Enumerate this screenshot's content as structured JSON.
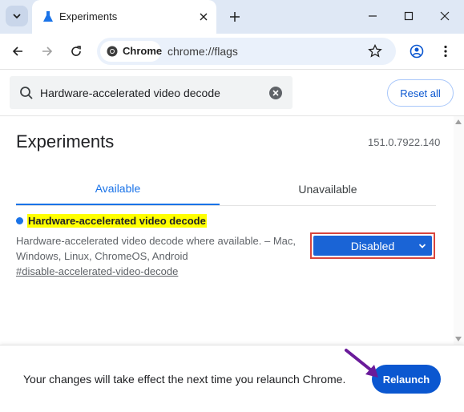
{
  "browser": {
    "tab": {
      "title": "Experiments"
    },
    "omnibox": {
      "chip_label": "Chrome",
      "url": "chrome://flags"
    }
  },
  "search": {
    "value": "Hardware-accelerated video decode",
    "reset_label": "Reset all"
  },
  "page": {
    "title": "Experiments",
    "version": "151.0.7922.140",
    "tabs": [
      {
        "label": "Available",
        "active": true
      },
      {
        "label": "Unavailable",
        "active": false
      }
    ]
  },
  "flag": {
    "name": "Hardware-accelerated video decode",
    "description": "Hardware-accelerated video decode where available. – Mac, Windows, Linux, ChromeOS, Android",
    "link": "#disable-accelerated-video-decode",
    "selected_option": "Disabled"
  },
  "relaunch": {
    "message": "Your changes will take effect the next time you relaunch Chrome.",
    "button_label": "Relaunch"
  },
  "colors": {
    "accent": "#1a73e8",
    "select_bg": "#1a64d6",
    "highlight": "#ffff00",
    "annotation_box": "#d9453d",
    "annotation_arrow": "#6a1b9a",
    "relaunch_button": "#0b57d0"
  },
  "icons": [
    "tab-search-icon",
    "experiments-flask-icon",
    "close-icon",
    "plus-icon",
    "minimize-icon",
    "maximize-icon",
    "back-arrow-icon",
    "forward-arrow-icon",
    "reload-icon",
    "chrome-logo-icon",
    "star-icon",
    "profile-icon",
    "menu-kebab-icon",
    "search-icon",
    "clear-icon",
    "chevron-down-icon",
    "arrow-annotation"
  ]
}
